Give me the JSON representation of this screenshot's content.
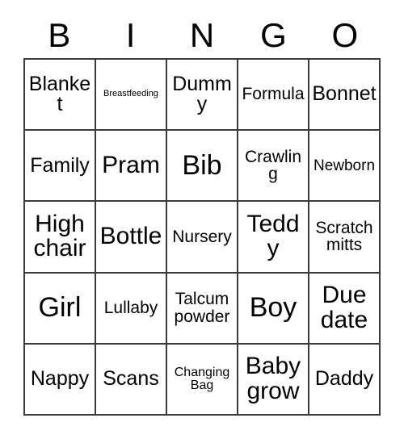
{
  "card": {
    "title": "BINGO",
    "header_letters": [
      "B",
      "I",
      "N",
      "G",
      "O"
    ],
    "grid": {
      "columns": 5,
      "rows": 5,
      "cells": [
        [
          {
            "text": "Blanket",
            "size": "lg"
          },
          {
            "text": "Breastfeeding",
            "size": "xxs"
          },
          {
            "text": "Dummy",
            "size": "lg"
          },
          {
            "text": "Formula",
            "size": "md"
          },
          {
            "text": "Bonnet",
            "size": "lg"
          }
        ],
        [
          {
            "text": "Family",
            "size": "lg"
          },
          {
            "text": "Pram",
            "size": "xl"
          },
          {
            "text": "Bib",
            "size": "xxl"
          },
          {
            "text": "Crawling",
            "size": "md"
          },
          {
            "text": "Newborn",
            "size": "sm"
          }
        ],
        [
          {
            "text": "High chair",
            "size": "xl"
          },
          {
            "text": "Bottle",
            "size": "xl"
          },
          {
            "text": "Nursery",
            "size": "md"
          },
          {
            "text": "Teddy",
            "size": "xl"
          },
          {
            "text": "Scratch mitts",
            "size": "md"
          }
        ],
        [
          {
            "text": "Girl",
            "size": "xxl"
          },
          {
            "text": "Lullaby",
            "size": "md"
          },
          {
            "text": "Talcum powder",
            "size": "md"
          },
          {
            "text": "Boy",
            "size": "xxl"
          },
          {
            "text": "Due date",
            "size": "xl"
          }
        ],
        [
          {
            "text": "Nappy",
            "size": "lg"
          },
          {
            "text": "Scans",
            "size": "lg"
          },
          {
            "text": "Changing Bag",
            "size": "xs"
          },
          {
            "text": "Baby grow",
            "size": "xl"
          },
          {
            "text": "Daddy",
            "size": "lg"
          }
        ]
      ]
    },
    "colors": {
      "background": "#ffffff",
      "text": "#000000",
      "grid_line": "#3b3b3b"
    }
  }
}
